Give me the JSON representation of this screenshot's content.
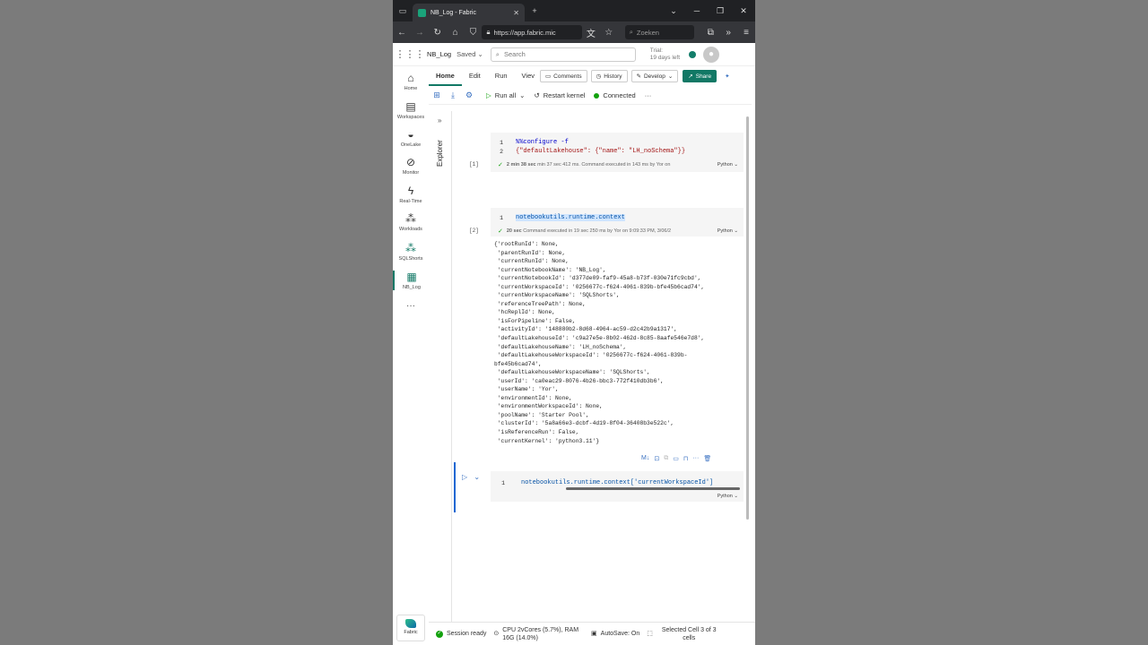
{
  "browser": {
    "tab_title": "NB_Log - Fabric",
    "url": "https://app.fabric.mic",
    "search_placeholder": "Zoeken"
  },
  "app": {
    "notebook_name": "NB_Log",
    "saved_label": "Saved",
    "search_placeholder": "Search",
    "trial_line1": "Trial:",
    "trial_line2": "19 days left"
  },
  "rail": {
    "items": [
      {
        "label": "Home"
      },
      {
        "label": "Workspaces"
      },
      {
        "label": "OneLake"
      },
      {
        "label": "Monitor"
      },
      {
        "label": "Real-Time"
      },
      {
        "label": "Workloads"
      },
      {
        "label": "SQLShorts"
      },
      {
        "label": "NB_Log"
      }
    ],
    "more": "···",
    "fabric_label": "Fabric"
  },
  "ribbon": {
    "tabs": [
      "Home",
      "Edit",
      "Run",
      "Viev"
    ],
    "comments": "Comments",
    "history": "History",
    "develop": "Develop",
    "share": "Share"
  },
  "toolbar": {
    "run_all": "Run all",
    "restart_kernel": "Restart kernel",
    "connected": "Connected",
    "more": "···"
  },
  "explorer": {
    "label": "Explorer"
  },
  "cells": [
    {
      "number": "[1]",
      "lines": [
        "%%configure -f",
        "{\"defaultLakehouse\": {\"name\": \"LH_noSchema\"}}"
      ],
      "exec_bold": "2 min 38 sec",
      "exec_rest": "min 37 sec 412 ms. Command executed in 143 ms by Yor on",
      "lang": "Python"
    },
    {
      "number": "[2]",
      "lines": [
        "notebookutils.runtime.context"
      ],
      "exec_bold": "20 sec",
      "exec_rest": "Command executed in 19 sec 250 ms by Yor on 9:09:33 PM, 3/06/2",
      "lang": "Python"
    },
    {
      "lines": [
        "notebookutils.runtime.context['currentWorkspaceId']"
      ],
      "lang": "Python"
    }
  ],
  "output_lines": [
    "{'rootRunId': None,",
    " 'parentRunId': None,",
    " 'currentRunId': None,",
    " 'currentNotebookName': 'NB_Log',",
    " 'currentNotebookId': 'd377de09-faf9-45a8-b73f-030e71fc9cbd',",
    " 'currentWorkspaceId': '0256677c-f624-4061-839b-bfe45b6cad74',",
    " 'currentWorkspaceName': 'SQLShorts',",
    " 'referenceTreePath': None,",
    " 'hcReplId': None,",
    " 'isForPipeline': False,",
    " 'activityId': '148880b2-8d68-4964-ac59-d2c42b9a1317',",
    " 'defaultLakehouseId': 'c9a27e5e-8b02-462d-8c85-8aafe546e7d8',",
    " 'defaultLakehouseName': 'LH_noSchema',",
    " 'defaultLakehouseWorkspaceId': '0256677c-f624-4061-839b-",
    "bfe45b6cad74',",
    " 'defaultLakehouseWorkspaceName': 'SQLShorts',",
    " 'userId': 'ca0eac29-8076-4b26-bbc3-772f410db3b6',",
    " 'userName': 'Yor',",
    " 'environmentId': None,",
    " 'environmentWorkspaceId': None,",
    " 'poolName': 'Starter Pool',",
    " 'clusterId': '5a8a66e3-dcbf-4d19-8f04-36408b3e522c',",
    " 'isReferenceRun': False,",
    " 'currentKernel': 'python3.11'}"
  ],
  "status": {
    "session": "Session ready",
    "cpu_line1": "CPU 2vCores (5.7%), RAM",
    "cpu_line2": "16G (14.0%)",
    "autosave": "AutoSave: On",
    "selected_line1": "Selected Cell 3 of 3",
    "selected_line2": "cells"
  },
  "colors": {
    "accent": "#117865",
    "success": "#13a10e",
    "active_cell": "#1967d2"
  }
}
